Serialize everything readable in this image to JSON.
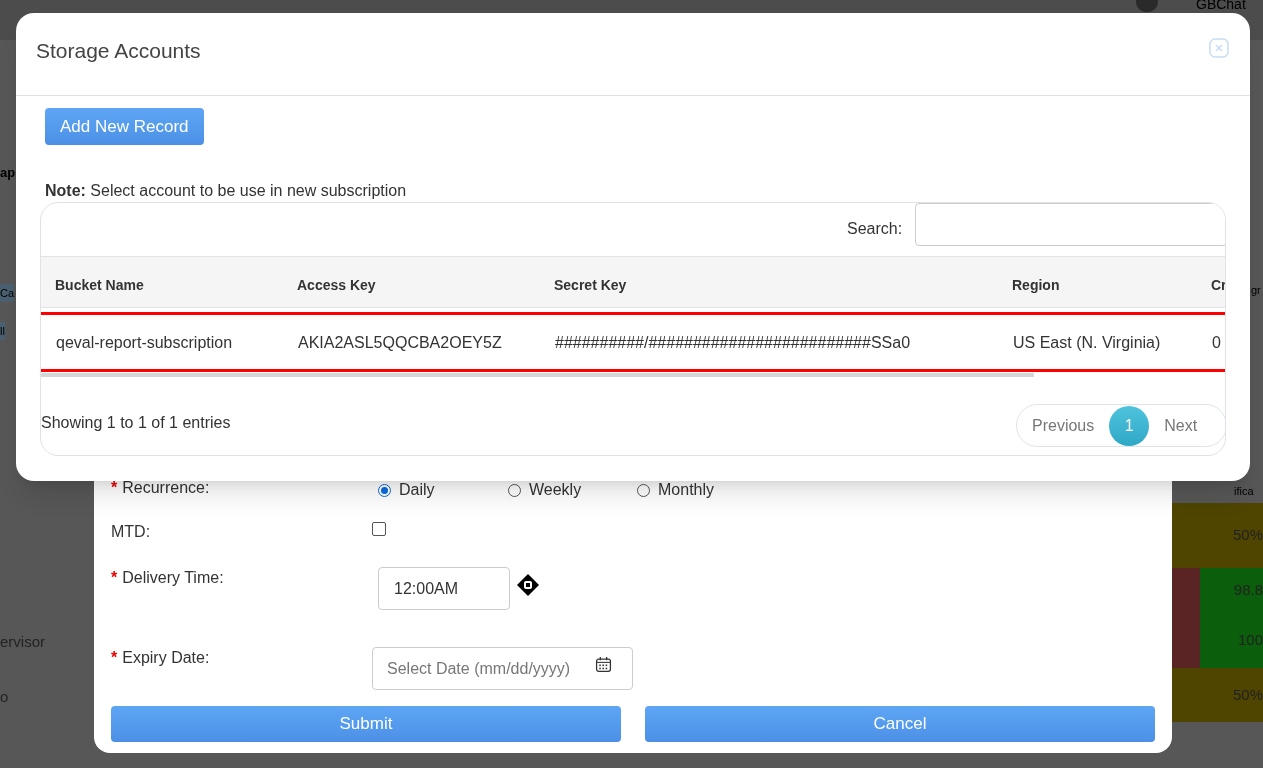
{
  "background_page": {
    "user_label": "GBChat",
    "heading_fragment": "ap",
    "chip_fragments": [
      "Ca",
      "ll"
    ],
    "right_fragments": [
      "gr",
      "ifica"
    ],
    "row_fragments": [
      "ervisor",
      "o"
    ],
    "score_cells": [
      {
        "text": "50%",
        "color": "#4f4500"
      },
      {
        "text": "98.8",
        "color": "#0b5e0b"
      },
      {
        "text": "100",
        "color": "#0b5e0b"
      },
      {
        "text": "50%",
        "color": "#4f4500"
      }
    ]
  },
  "subscription_form": {
    "fields": [
      {
        "kind": "radio",
        "label": "Recurrence:",
        "required": "*",
        "options": [
          {
            "label": "Daily",
            "selected": true
          },
          {
            "label": "Weekly",
            "selected": false
          },
          {
            "label": "Monthly",
            "selected": false
          }
        ]
      },
      {
        "kind": "checkbox",
        "label": "MTD:",
        "checked": false
      },
      {
        "kind": "time",
        "label": "Delivery Time:",
        "required": "*",
        "value": "12:00AM"
      },
      {
        "kind": "date",
        "label": "Expiry Date:",
        "required": "*",
        "placeholder": "Select Date (mm/dd/yyyy)"
      }
    ],
    "buttons": [
      "Submit",
      "Cancel"
    ]
  },
  "dialog": {
    "title": "Storage Accounts",
    "add_button": "Add New Record",
    "note_label": "Note:",
    "note": "Select account to be use in new subscription",
    "search_label": "Search:",
    "table": {
      "columns": [
        "Bucket Name",
        "Access Key",
        "Secret Key",
        "Region",
        "Cr"
      ],
      "rows": [
        {
          "selected": true,
          "cells": [
            "qeval-report-subscription",
            "AKIA2ASL5QQCBA2OEY5Z",
            "##########/#########################SSa0",
            "US East (N. Virginia)",
            "0"
          ]
        }
      ]
    },
    "info": "Showing 1 to 1 of 1 entries",
    "pagination": [
      {
        "label": "Previous",
        "kind": "nav",
        "selected": false
      },
      {
        "label": "1",
        "kind": "page",
        "selected": true
      },
      {
        "label": "Next",
        "kind": "nav",
        "selected": false
      }
    ]
  }
}
